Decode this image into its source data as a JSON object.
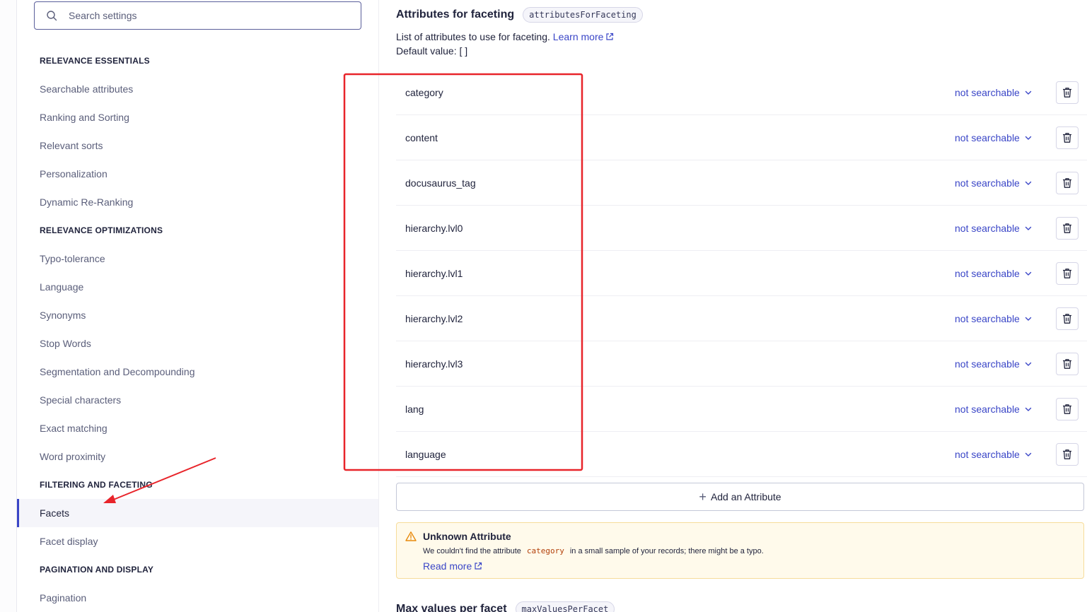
{
  "sidebar": {
    "search_placeholder": "Search settings",
    "sections": [
      {
        "title": "RELEVANCE ESSENTIALS",
        "items": [
          "Searchable attributes",
          "Ranking and Sorting",
          "Relevant sorts",
          "Personalization",
          "Dynamic Re-Ranking"
        ]
      },
      {
        "title": "RELEVANCE OPTIMIZATIONS",
        "items": [
          "Typo-tolerance",
          "Language",
          "Synonyms",
          "Stop Words",
          "Segmentation and Decompounding",
          "Special characters",
          "Exact matching",
          "Word proximity"
        ]
      },
      {
        "title": "FILTERING AND FACETING",
        "items": [
          "Facets",
          "Facet display"
        ]
      },
      {
        "title": "PAGINATION AND DISPLAY",
        "items": [
          "Pagination"
        ]
      }
    ],
    "active_item": "Facets"
  },
  "setting": {
    "title": "Attributes for faceting",
    "code": "attributesForFaceting",
    "description": "List of attributes to use for faceting.",
    "learn_more": "Learn more",
    "default_value": "Default value: [ ]"
  },
  "attributes": [
    {
      "name": "category",
      "mode": "not searchable"
    },
    {
      "name": "content",
      "mode": "not searchable"
    },
    {
      "name": "docusaurus_tag",
      "mode": "not searchable"
    },
    {
      "name": "hierarchy.lvl0",
      "mode": "not searchable"
    },
    {
      "name": "hierarchy.lvl1",
      "mode": "not searchable"
    },
    {
      "name": "hierarchy.lvl2",
      "mode": "not searchable"
    },
    {
      "name": "hierarchy.lvl3",
      "mode": "not searchable"
    },
    {
      "name": "lang",
      "mode": "not searchable"
    },
    {
      "name": "language",
      "mode": "not searchable"
    }
  ],
  "add_attribute": {
    "icon": "plus-icon",
    "label": "Add an Attribute"
  },
  "warning": {
    "icon": "warning-triangle-icon",
    "title": "Unknown Attribute",
    "text_before": "We couldn't find the attribute",
    "code": "category",
    "text_after": "in a small sample of your records; there might be a typo.",
    "link": "Read more"
  },
  "next_setting": {
    "title": "Max values per facet",
    "code": "maxValuesPerFacet"
  },
  "colors": {
    "accent": "#3a46c7",
    "annotation": "#e8242a",
    "warning_bg": "#fffaeb",
    "warning_code": "#b3400a"
  }
}
